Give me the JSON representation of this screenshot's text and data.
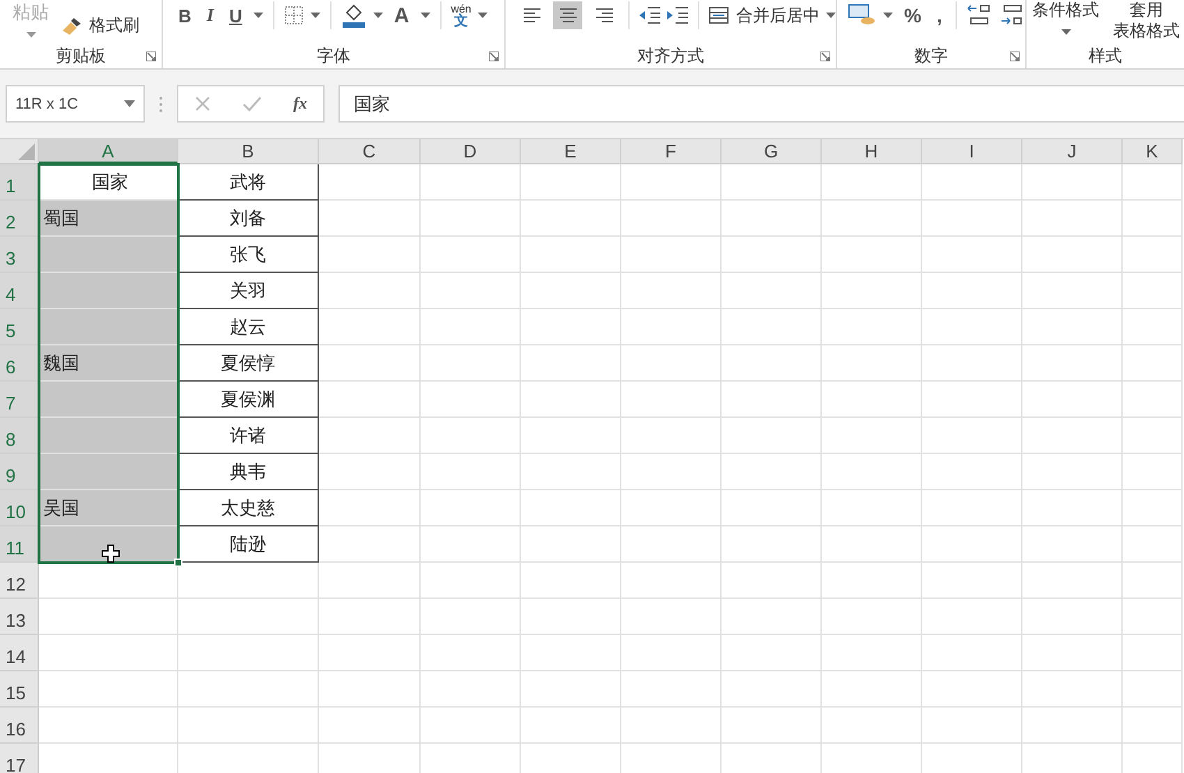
{
  "ribbon": {
    "clipboard": {
      "paste": "粘贴",
      "format_painter": "格式刷",
      "label": "剪贴板"
    },
    "font": {
      "bold": "B",
      "italic": "I",
      "underline": "U",
      "font_color": "A",
      "phonetic_top": "wén",
      "phonetic_bottom": "文",
      "label": "字体"
    },
    "alignment": {
      "align_buttons": [
        {
          "kind": "left",
          "selected": false
        },
        {
          "kind": "center",
          "selected": true
        },
        {
          "kind": "right",
          "selected": false
        }
      ],
      "merge": "合并后居中",
      "label": "对齐方式"
    },
    "number": {
      "percent": "%",
      "comma": ",",
      "label": "数字"
    },
    "styles": {
      "conditional": "条件格式",
      "table_top": "套用",
      "table_bottom": "表格格式",
      "label": "样式"
    }
  },
  "formula_bar": {
    "name_box": "11R x 1C",
    "fx": "fx",
    "value": "国家"
  },
  "columns": [
    {
      "label": "A",
      "selected": true
    },
    {
      "label": "B",
      "selected": false
    },
    {
      "label": "C",
      "selected": false
    },
    {
      "label": "D",
      "selected": false
    },
    {
      "label": "E",
      "selected": false
    },
    {
      "label": "F",
      "selected": false
    },
    {
      "label": "G",
      "selected": false
    },
    {
      "label": "H",
      "selected": false
    },
    {
      "label": "I",
      "selected": false
    },
    {
      "label": "J",
      "selected": false
    },
    {
      "label": "K",
      "selected": false
    }
  ],
  "rows": [
    {
      "number": "1",
      "selected": true,
      "cells": [
        "国家",
        "武将"
      ]
    },
    {
      "number": "2",
      "selected": true,
      "cells": [
        "蜀国",
        "刘备"
      ]
    },
    {
      "number": "3",
      "selected": true,
      "cells": [
        "",
        "张飞"
      ]
    },
    {
      "number": "4",
      "selected": true,
      "cells": [
        "",
        "关羽"
      ]
    },
    {
      "number": "5",
      "selected": true,
      "cells": [
        "",
        "赵云"
      ]
    },
    {
      "number": "6",
      "selected": true,
      "cells": [
        "魏国",
        "夏侯惇"
      ]
    },
    {
      "number": "7",
      "selected": true,
      "cells": [
        "",
        "夏侯渊"
      ]
    },
    {
      "number": "8",
      "selected": true,
      "cells": [
        "",
        "许诸"
      ]
    },
    {
      "number": "9",
      "selected": true,
      "cells": [
        "",
        "典韦"
      ]
    },
    {
      "number": "10",
      "selected": true,
      "cells": [
        "吴国",
        "太史慈"
      ]
    },
    {
      "number": "11",
      "selected": true,
      "cells": [
        "",
        "陆逊"
      ]
    },
    {
      "number": "12",
      "selected": false,
      "cells": []
    },
    {
      "number": "13",
      "selected": false,
      "cells": []
    },
    {
      "number": "14",
      "selected": false,
      "cells": []
    },
    {
      "number": "15",
      "selected": false,
      "cells": []
    },
    {
      "number": "16",
      "selected": false,
      "cells": []
    },
    {
      "number": "17",
      "selected": false,
      "cells": []
    }
  ]
}
